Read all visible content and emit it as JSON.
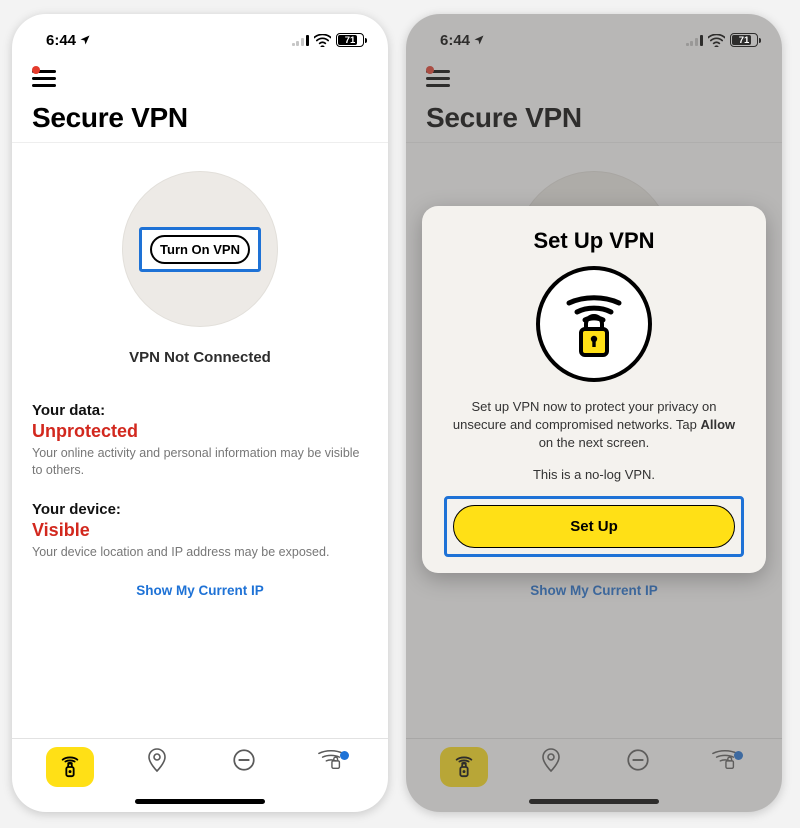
{
  "status": {
    "time": "6:44",
    "battery_level": "71"
  },
  "header": {
    "page_title": "Secure VPN"
  },
  "main": {
    "turn_on_label": "Turn On VPN",
    "vpn_status": "VPN Not Connected",
    "data": {
      "label": "Your data:",
      "status": "Unprotected",
      "desc": "Your online activity and personal information may be visible to others."
    },
    "device": {
      "label": "Your device:",
      "status": "Visible",
      "desc": "Your device location and IP address may be exposed."
    },
    "show_ip": "Show My Current IP"
  },
  "modal": {
    "title": "Set Up VPN",
    "desc_a": "Set up VPN now to protect your privacy on unsecure and compromised networks. Tap ",
    "desc_bold": "Allow",
    "desc_b": " on the next screen.",
    "nolog": "This is a no-log VPN.",
    "setup_btn": "Set Up"
  }
}
